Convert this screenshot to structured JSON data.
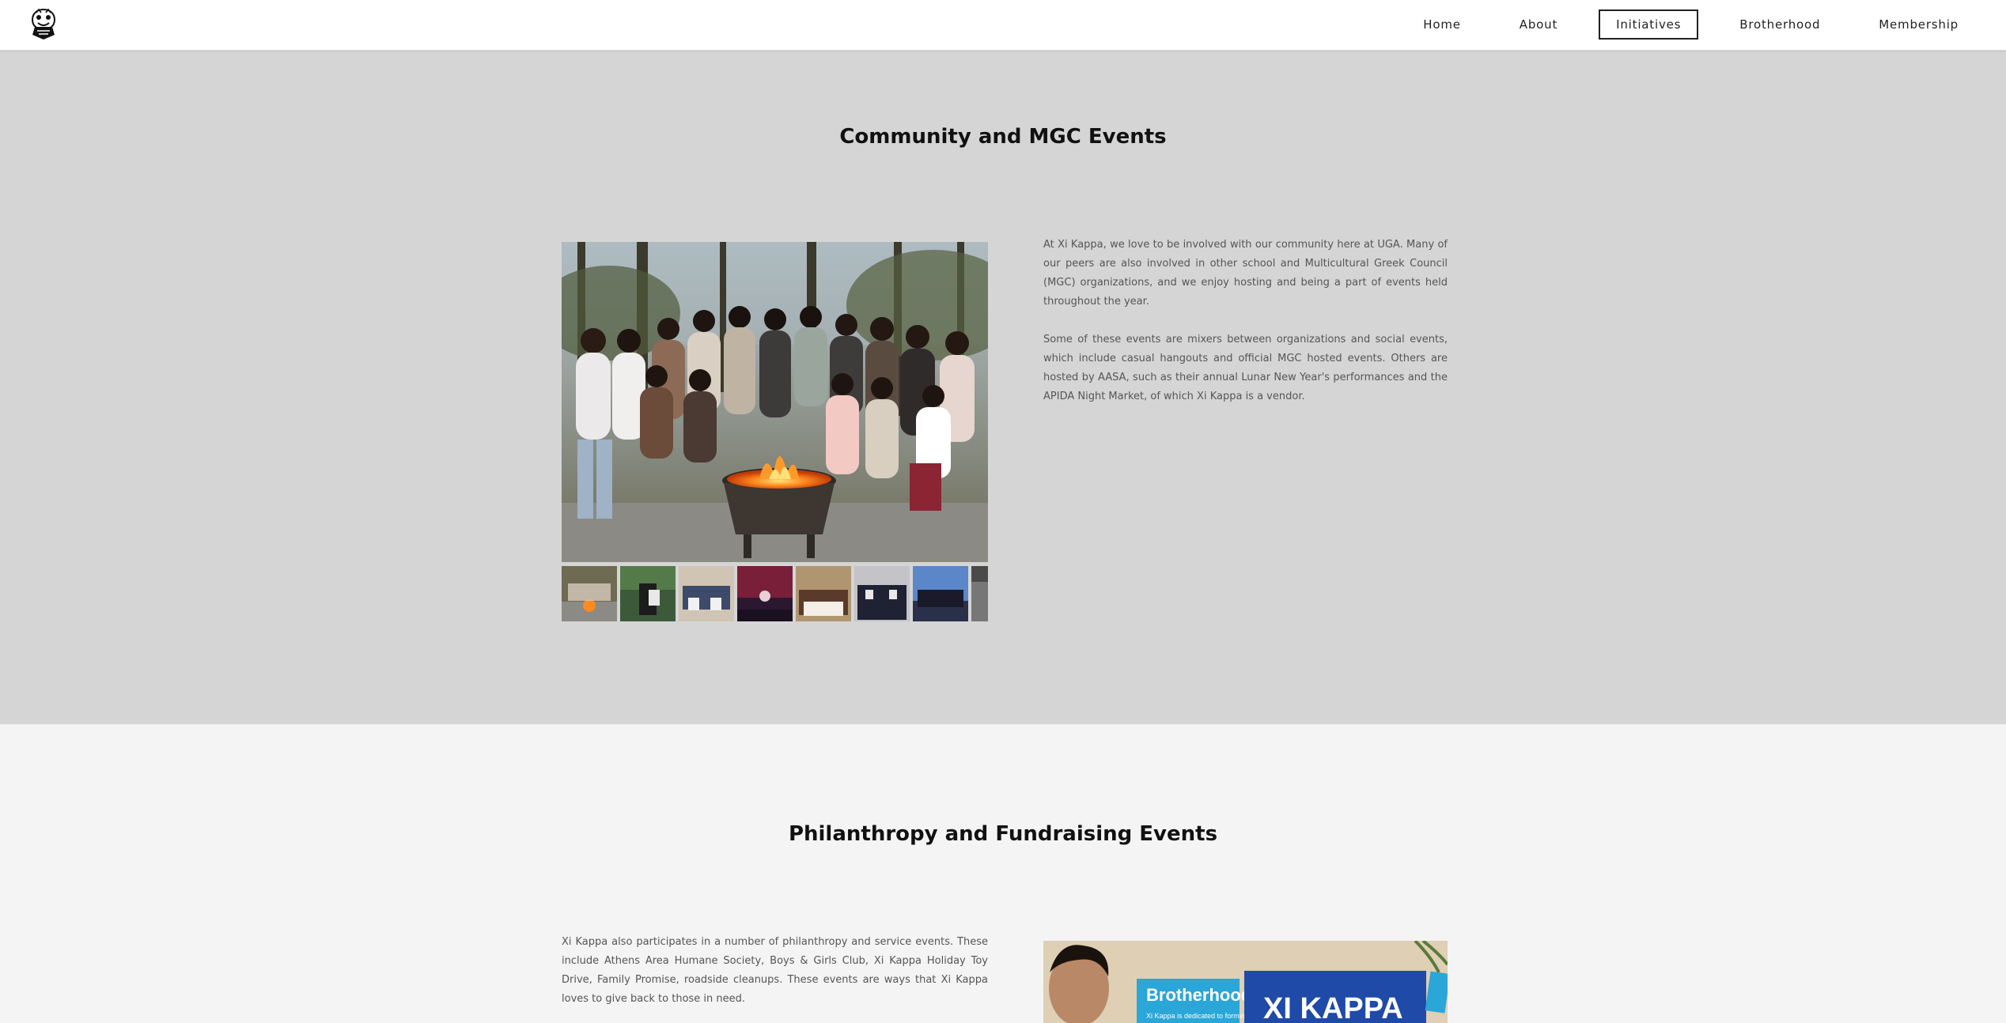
{
  "nav": {
    "logo_name": "crest-logo-icon",
    "items": [
      {
        "label": "Home",
        "active": false
      },
      {
        "label": "About",
        "active": false
      },
      {
        "label": "Initiatives",
        "active": true
      },
      {
        "label": "Brotherhood",
        "active": false
      },
      {
        "label": "Membership",
        "active": false
      }
    ]
  },
  "community": {
    "title": "Community and MGC Events",
    "paragraphs": [
      "At Xi Kappa, we love to be involved with our community here at UGA. Many of our peers are also involved in other school and Multicultural Greek Council (MGC) organizations, and we enjoy hosting and being a part of events held throughout the year.",
      "Some of these events are mixers between organizations and social events, which include casual hangouts and official MGC hosted events. Others are hosted by AASA, such as their annual Lunar New Year's performances and the APIDA Night Market, of which Xi Kappa is a vendor."
    ],
    "thumbnails": 8
  },
  "philanthropy": {
    "title": "Philanthropy and Fundraising Events",
    "paragraph": "Xi Kappa also participates in a number of philanthropy and service events. These include Athens Area Humane Society, Boys & Girls Club, Xi Kappa Holiday Toy Drive, Family Promise, roadside cleanups. These events are ways that Xi Kappa loves to give back to those in need.",
    "poster": {
      "headline": "Brotherhood",
      "subline": "Xi Kappa is dedicated to forming",
      "banner": "XI KAPPA"
    }
  },
  "colors": {
    "section1_bg": "#d5d5d5",
    "section2_bg": "#f4f4f4",
    "poster_blue": "#1f4aa8",
    "poster_cyan": "#2aa6d8"
  }
}
